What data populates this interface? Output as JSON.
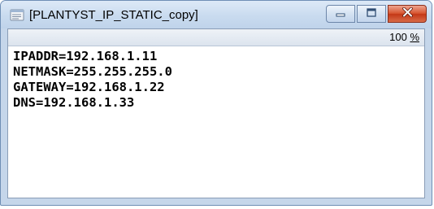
{
  "window": {
    "title": "[PLANTYST_IP_STATIC_copy]",
    "app_icon": "document-icon",
    "buttons": {
      "minimize": "minimize-icon",
      "maximize": "maximize-icon",
      "close": "close-icon"
    },
    "colors": {
      "close_button": "#c43716",
      "frame": "#c5d6ea"
    }
  },
  "statusbar": {
    "zoom_value": "100",
    "zoom_unit": "%"
  },
  "content": {
    "lines": [
      "IPADDR=192.168.1.11",
      "NETMASK=255.255.255.0",
      "GATEWAY=192.168.1.22",
      "DNS=192.168.1.33"
    ]
  }
}
